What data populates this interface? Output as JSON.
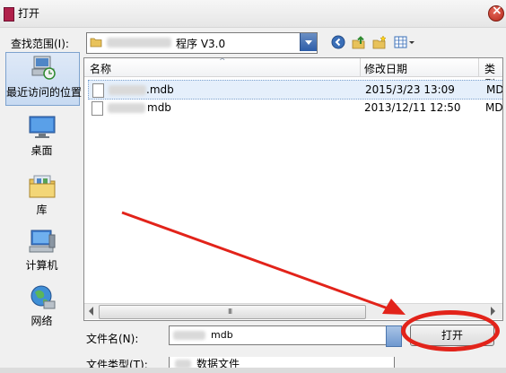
{
  "window": {
    "title": "打开"
  },
  "toolbar": {
    "look_in_label": "查找范围(I):",
    "look_in_value": "程序 V3.0"
  },
  "places": [
    {
      "label": "最近访问的位置",
      "icon": "recent-places-icon"
    },
    {
      "label": "桌面",
      "icon": "desktop-icon"
    },
    {
      "label": "库",
      "icon": "libraries-icon"
    },
    {
      "label": "计算机",
      "icon": "computer-icon"
    },
    {
      "label": "网络",
      "icon": "network-icon"
    }
  ],
  "columns": {
    "name": "名称",
    "modified": "修改日期",
    "type": "类型"
  },
  "files": [
    {
      "name_visible": ".mdb",
      "modified": "2015/3/23 13:09",
      "type": "MD",
      "selected": true
    },
    {
      "name_visible": "mdb",
      "modified": "2013/12/11 12:50",
      "type": "MD",
      "selected": false
    }
  ],
  "scrollbar": {
    "grip": "III"
  },
  "filename": {
    "label": "文件名(N):",
    "value_visible": "mdb"
  },
  "filetype": {
    "label": "文件类型(T):",
    "value_visible": "数据文件"
  },
  "buttons": {
    "open": "打开"
  },
  "colors": {
    "annotation": "#e2231a",
    "selection": "#e5effb",
    "accent": "#2c5ca8"
  }
}
